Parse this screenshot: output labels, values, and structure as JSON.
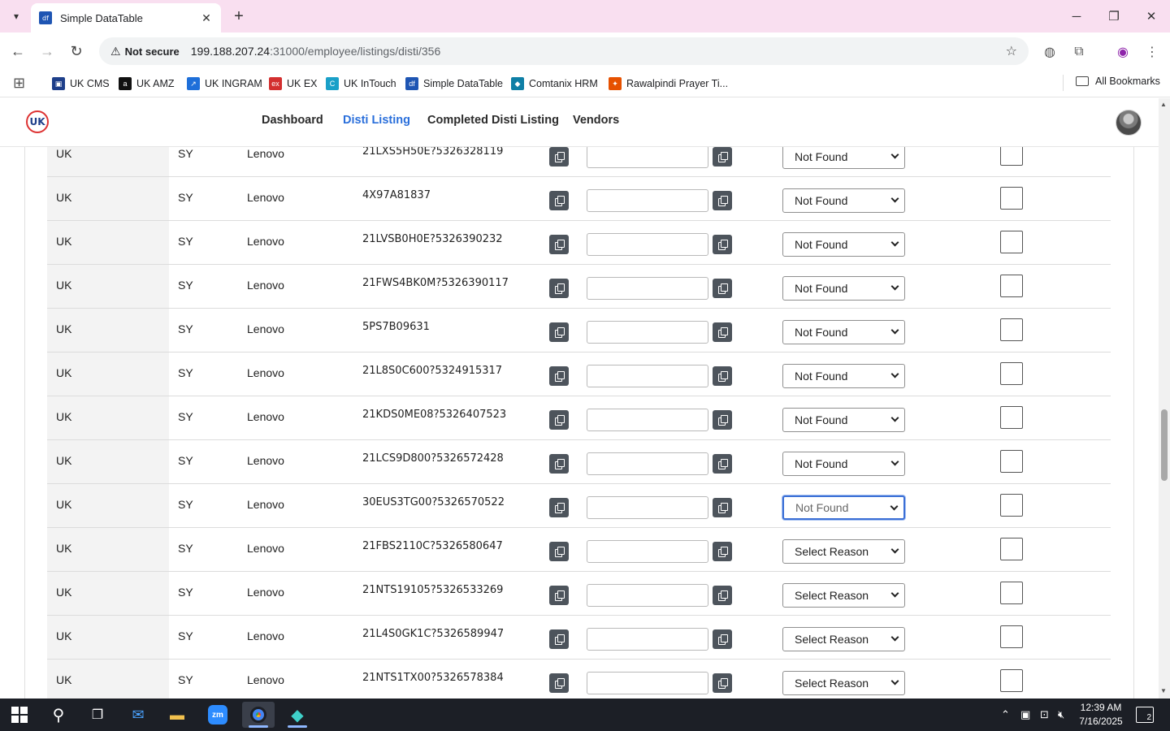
{
  "browser": {
    "tab_title": "Simple DataTable",
    "tab_favicon": "df",
    "security_label": "Not secure",
    "url_host": "199.188.207.24",
    "url_rest": ":31000/employee/listings/disti/356",
    "bookmarks": [
      {
        "label": "UK CMS",
        "color": "#1e3f8a",
        "glyph": "▣"
      },
      {
        "label": "UK AMZ",
        "color": "#111111",
        "glyph": "a"
      },
      {
        "label": "UK INGRAM",
        "color": "#1e6fd9",
        "glyph": "↗"
      },
      {
        "label": "UK EX",
        "color": "#d32f2f",
        "glyph": "ex"
      },
      {
        "label": "UK InTouch",
        "color": "#1aa0c8",
        "glyph": "C"
      },
      {
        "label": "Simple DataTable",
        "color": "#1e55b3",
        "glyph": "df"
      },
      {
        "label": "Comtanix HRM",
        "color": "#0e7fa6",
        "glyph": "◆"
      },
      {
        "label": "Rawalpindi Prayer Ti...",
        "color": "#e65100",
        "glyph": "✦"
      }
    ],
    "all_bookmarks_label": "All Bookmarks"
  },
  "app": {
    "logo_text": "UK",
    "nav": [
      {
        "label": "Dashboard",
        "active": false
      },
      {
        "label": "Disti Listing",
        "active": true
      },
      {
        "label": "Completed Disti Listing",
        "active": false
      },
      {
        "label": "Vendors",
        "active": false
      }
    ]
  },
  "table": {
    "rows": [
      {
        "region": "UK",
        "code": "SY",
        "vendor": "Lenovo",
        "sku": "21LXS5H50E?5326328119",
        "reason": "Not Found",
        "focused": false
      },
      {
        "region": "UK",
        "code": "SY",
        "vendor": "Lenovo",
        "sku": "4X97A81837",
        "reason": "Not Found",
        "focused": false
      },
      {
        "region": "UK",
        "code": "SY",
        "vendor": "Lenovo",
        "sku": "21LVSB0H0E?5326390232",
        "reason": "Not Found",
        "focused": false
      },
      {
        "region": "UK",
        "code": "SY",
        "vendor": "Lenovo",
        "sku": "21FWS4BK0M?5326390117",
        "reason": "Not Found",
        "focused": false
      },
      {
        "region": "UK",
        "code": "SY",
        "vendor": "Lenovo",
        "sku": "5PS7B09631",
        "reason": "Not Found",
        "focused": false
      },
      {
        "region": "UK",
        "code": "SY",
        "vendor": "Lenovo",
        "sku": "21L8S0C600?5324915317",
        "reason": "Not Found",
        "focused": false
      },
      {
        "region": "UK",
        "code": "SY",
        "vendor": "Lenovo",
        "sku": "21KDS0ME08?5326407523",
        "reason": "Not Found",
        "focused": false
      },
      {
        "region": "UK",
        "code": "SY",
        "vendor": "Lenovo",
        "sku": "21LCS9D800?5326572428",
        "reason": "Not Found",
        "focused": false
      },
      {
        "region": "UK",
        "code": "SY",
        "vendor": "Lenovo",
        "sku": "30EUS3TG00?5326570522",
        "reason": "Not Found",
        "focused": true
      },
      {
        "region": "UK",
        "code": "SY",
        "vendor": "Lenovo",
        "sku": "21FBS2110C?5326580647",
        "reason": "Select Reason",
        "focused": false
      },
      {
        "region": "UK",
        "code": "SY",
        "vendor": "Lenovo",
        "sku": "21NTS19105?5326533269",
        "reason": "Select Reason",
        "focused": false
      },
      {
        "region": "UK",
        "code": "SY",
        "vendor": "Lenovo",
        "sku": "21L4S0GK1C?5326589947",
        "reason": "Select Reason",
        "focused": false
      },
      {
        "region": "UK",
        "code": "SY",
        "vendor": "Lenovo",
        "sku": "21NTS1TX00?5326578384",
        "reason": "Select Reason",
        "focused": false
      }
    ]
  },
  "taskbar": {
    "time": "12:39 AM",
    "date": "7/16/2025",
    "notification_count": "2"
  },
  "colors": {
    "accent": "#2a6fdb",
    "tabstrip": "#f9dff0",
    "copy_button": "#4d545c",
    "taskbar": "#1c1f26"
  }
}
